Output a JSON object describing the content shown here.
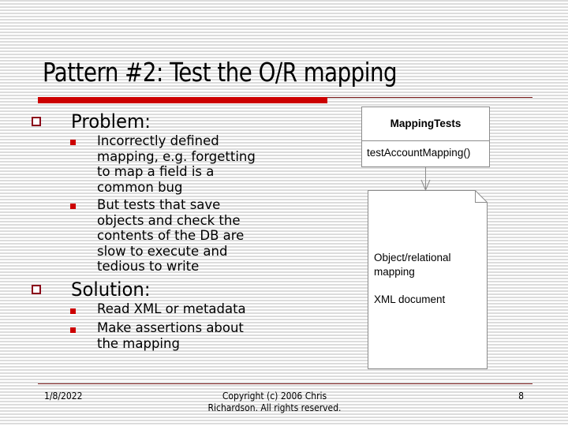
{
  "slide": {
    "title": "Pattern #2: Test the O/R mapping",
    "sections": [
      {
        "heading": "Problem:",
        "bullets": [
          "Incorrectly defined\nmapping, e.g. forgetting\nto map a field is a\ncommon bug",
          "But tests that save\nobjects and check the\ncontents of the DB are\nslow to execute and\ntedious to write"
        ]
      },
      {
        "heading": "Solution:",
        "bullets": [
          "Read XML or metadata",
          "Make assertions about\nthe mapping"
        ]
      }
    ]
  },
  "diagram": {
    "class_name": "MappingTests",
    "class_method": "testAccountMapping()",
    "document_labels": [
      "Object/relational\nmapping",
      "XML document"
    ],
    "colors": {
      "border": "#8c8c8c",
      "accent_red": "#cc0000",
      "bullet_outline": "#8b0a1a"
    }
  },
  "footer": {
    "date": "1/8/2022",
    "copyright": "Copyright (c)  2006 Chris\nRichardson. All rights reserved.",
    "page_number": "8"
  },
  "icons": {
    "level1_bullet": "hollow-square-icon",
    "level2_bullet": "filled-square-icon"
  }
}
